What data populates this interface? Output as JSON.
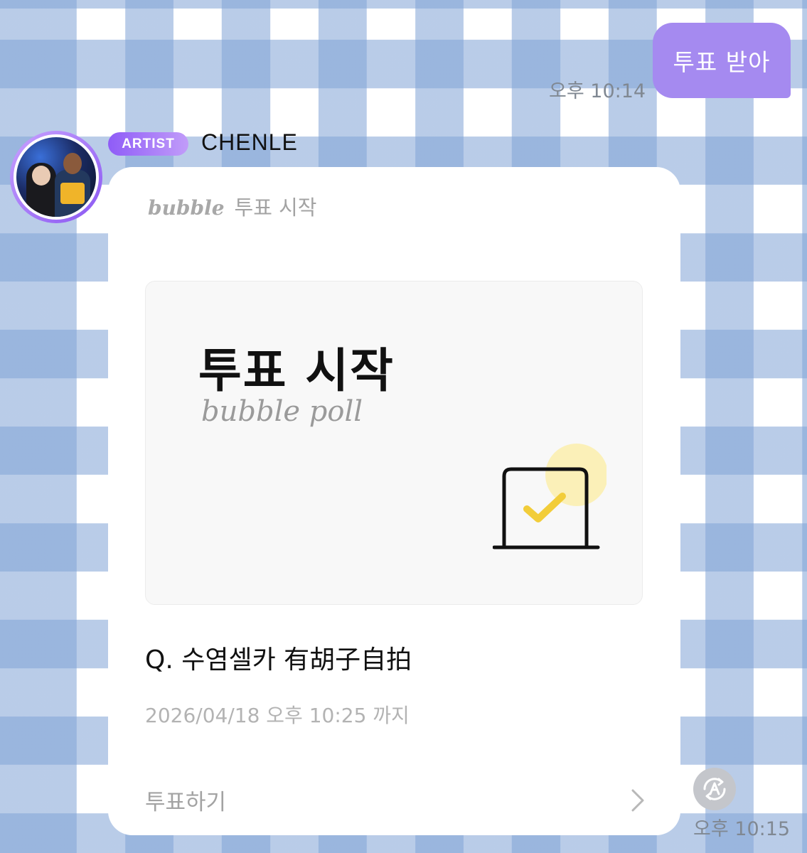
{
  "outgoing_message": {
    "text": "투표 받아",
    "time": "오후 10:14"
  },
  "sender": {
    "badge": "ARTIST",
    "name": "CHENLE"
  },
  "poll_card": {
    "brand": "bubble",
    "kind": "투표 시작",
    "hero_title": "투표 시작",
    "hero_subtitle": "bubble poll",
    "question": "Q. 수염셀카 有胡子自拍",
    "deadline": "2026/04/18 오후 10:25 까지",
    "action_label": "투표하기",
    "time": "오후 10:15"
  },
  "colors": {
    "my_bubble": "#a58af0",
    "badge_start": "#8f5cf7",
    "badge_end": "#c19cf9",
    "check_mark": "#f2cd3a",
    "check_glow": "#fbf0b8"
  },
  "icons": {
    "hero": "ballot-checkbox-icon",
    "action": "chevron-right-icon",
    "translate": "translate-icon"
  }
}
